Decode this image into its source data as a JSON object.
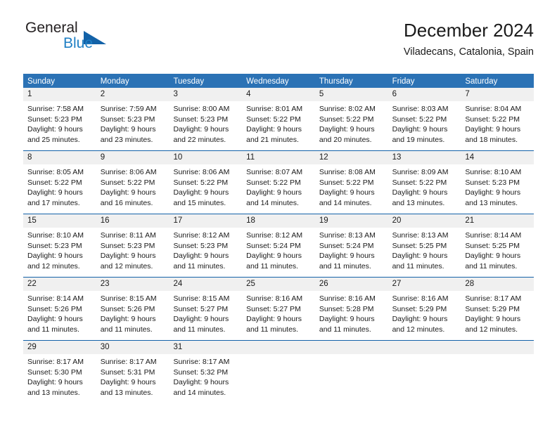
{
  "brand": {
    "name_part1": "General",
    "name_part2": "Blue",
    "logo_icon": "triangle-flag-icon"
  },
  "header": {
    "title": "December 2024",
    "subtitle": "Viladecans, Catalonia, Spain"
  },
  "colors": {
    "header_blue": "#2b72b5",
    "rule_blue": "#1362a8",
    "day_band_gray": "#f0f0f0",
    "brand_blue": "#1f7fc4",
    "text": "#1a1a1a"
  },
  "calendar": {
    "day_headers": [
      "Sunday",
      "Monday",
      "Tuesday",
      "Wednesday",
      "Thursday",
      "Friday",
      "Saturday"
    ],
    "weeks": [
      [
        {
          "day": "1",
          "sunrise": "Sunrise: 7:58 AM",
          "sunset": "Sunset: 5:23 PM",
          "daylight": "Daylight: 9 hours and 25 minutes."
        },
        {
          "day": "2",
          "sunrise": "Sunrise: 7:59 AM",
          "sunset": "Sunset: 5:23 PM",
          "daylight": "Daylight: 9 hours and 23 minutes."
        },
        {
          "day": "3",
          "sunrise": "Sunrise: 8:00 AM",
          "sunset": "Sunset: 5:23 PM",
          "daylight": "Daylight: 9 hours and 22 minutes."
        },
        {
          "day": "4",
          "sunrise": "Sunrise: 8:01 AM",
          "sunset": "Sunset: 5:22 PM",
          "daylight": "Daylight: 9 hours and 21 minutes."
        },
        {
          "day": "5",
          "sunrise": "Sunrise: 8:02 AM",
          "sunset": "Sunset: 5:22 PM",
          "daylight": "Daylight: 9 hours and 20 minutes."
        },
        {
          "day": "6",
          "sunrise": "Sunrise: 8:03 AM",
          "sunset": "Sunset: 5:22 PM",
          "daylight": "Daylight: 9 hours and 19 minutes."
        },
        {
          "day": "7",
          "sunrise": "Sunrise: 8:04 AM",
          "sunset": "Sunset: 5:22 PM",
          "daylight": "Daylight: 9 hours and 18 minutes."
        }
      ],
      [
        {
          "day": "8",
          "sunrise": "Sunrise: 8:05 AM",
          "sunset": "Sunset: 5:22 PM",
          "daylight": "Daylight: 9 hours and 17 minutes."
        },
        {
          "day": "9",
          "sunrise": "Sunrise: 8:06 AM",
          "sunset": "Sunset: 5:22 PM",
          "daylight": "Daylight: 9 hours and 16 minutes."
        },
        {
          "day": "10",
          "sunrise": "Sunrise: 8:06 AM",
          "sunset": "Sunset: 5:22 PM",
          "daylight": "Daylight: 9 hours and 15 minutes."
        },
        {
          "day": "11",
          "sunrise": "Sunrise: 8:07 AM",
          "sunset": "Sunset: 5:22 PM",
          "daylight": "Daylight: 9 hours and 14 minutes."
        },
        {
          "day": "12",
          "sunrise": "Sunrise: 8:08 AM",
          "sunset": "Sunset: 5:22 PM",
          "daylight": "Daylight: 9 hours and 14 minutes."
        },
        {
          "day": "13",
          "sunrise": "Sunrise: 8:09 AM",
          "sunset": "Sunset: 5:22 PM",
          "daylight": "Daylight: 9 hours and 13 minutes."
        },
        {
          "day": "14",
          "sunrise": "Sunrise: 8:10 AM",
          "sunset": "Sunset: 5:23 PM",
          "daylight": "Daylight: 9 hours and 13 minutes."
        }
      ],
      [
        {
          "day": "15",
          "sunrise": "Sunrise: 8:10 AM",
          "sunset": "Sunset: 5:23 PM",
          "daylight": "Daylight: 9 hours and 12 minutes."
        },
        {
          "day": "16",
          "sunrise": "Sunrise: 8:11 AM",
          "sunset": "Sunset: 5:23 PM",
          "daylight": "Daylight: 9 hours and 12 minutes."
        },
        {
          "day": "17",
          "sunrise": "Sunrise: 8:12 AM",
          "sunset": "Sunset: 5:23 PM",
          "daylight": "Daylight: 9 hours and 11 minutes."
        },
        {
          "day": "18",
          "sunrise": "Sunrise: 8:12 AM",
          "sunset": "Sunset: 5:24 PM",
          "daylight": "Daylight: 9 hours and 11 minutes."
        },
        {
          "day": "19",
          "sunrise": "Sunrise: 8:13 AM",
          "sunset": "Sunset: 5:24 PM",
          "daylight": "Daylight: 9 hours and 11 minutes."
        },
        {
          "day": "20",
          "sunrise": "Sunrise: 8:13 AM",
          "sunset": "Sunset: 5:25 PM",
          "daylight": "Daylight: 9 hours and 11 minutes."
        },
        {
          "day": "21",
          "sunrise": "Sunrise: 8:14 AM",
          "sunset": "Sunset: 5:25 PM",
          "daylight": "Daylight: 9 hours and 11 minutes."
        }
      ],
      [
        {
          "day": "22",
          "sunrise": "Sunrise: 8:14 AM",
          "sunset": "Sunset: 5:26 PM",
          "daylight": "Daylight: 9 hours and 11 minutes."
        },
        {
          "day": "23",
          "sunrise": "Sunrise: 8:15 AM",
          "sunset": "Sunset: 5:26 PM",
          "daylight": "Daylight: 9 hours and 11 minutes."
        },
        {
          "day": "24",
          "sunrise": "Sunrise: 8:15 AM",
          "sunset": "Sunset: 5:27 PM",
          "daylight": "Daylight: 9 hours and 11 minutes."
        },
        {
          "day": "25",
          "sunrise": "Sunrise: 8:16 AM",
          "sunset": "Sunset: 5:27 PM",
          "daylight": "Daylight: 9 hours and 11 minutes."
        },
        {
          "day": "26",
          "sunrise": "Sunrise: 8:16 AM",
          "sunset": "Sunset: 5:28 PM",
          "daylight": "Daylight: 9 hours and 11 minutes."
        },
        {
          "day": "27",
          "sunrise": "Sunrise: 8:16 AM",
          "sunset": "Sunset: 5:29 PM",
          "daylight": "Daylight: 9 hours and 12 minutes."
        },
        {
          "day": "28",
          "sunrise": "Sunrise: 8:17 AM",
          "sunset": "Sunset: 5:29 PM",
          "daylight": "Daylight: 9 hours and 12 minutes."
        }
      ],
      [
        {
          "day": "29",
          "sunrise": "Sunrise: 8:17 AM",
          "sunset": "Sunset: 5:30 PM",
          "daylight": "Daylight: 9 hours and 13 minutes."
        },
        {
          "day": "30",
          "sunrise": "Sunrise: 8:17 AM",
          "sunset": "Sunset: 5:31 PM",
          "daylight": "Daylight: 9 hours and 13 minutes."
        },
        {
          "day": "31",
          "sunrise": "Sunrise: 8:17 AM",
          "sunset": "Sunset: 5:32 PM",
          "daylight": "Daylight: 9 hours and 14 minutes."
        },
        {
          "day": "",
          "sunrise": "",
          "sunset": "",
          "daylight": ""
        },
        {
          "day": "",
          "sunrise": "",
          "sunset": "",
          "daylight": ""
        },
        {
          "day": "",
          "sunrise": "",
          "sunset": "",
          "daylight": ""
        },
        {
          "day": "",
          "sunrise": "",
          "sunset": "",
          "daylight": ""
        }
      ]
    ]
  }
}
